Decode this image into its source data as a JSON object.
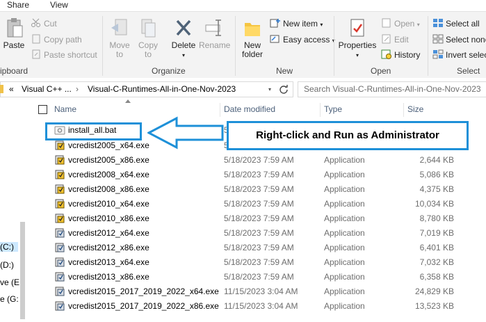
{
  "ribbon_tabs": [
    "Share",
    "View"
  ],
  "clipboard": {
    "paste": "Paste",
    "cut": "Cut",
    "copy_path": "Copy path",
    "paste_shortcut": "Paste shortcut",
    "group": "ipboard"
  },
  "organize": {
    "move_to": [
      "Move",
      "to"
    ],
    "copy_to": [
      "Copy",
      "to"
    ],
    "delete": "Delete",
    "rename": "Rename",
    "group": "Organize"
  },
  "new": {
    "new_folder": [
      "New",
      "folder"
    ],
    "new_item": "New item",
    "easy_access": "Easy access",
    "group": "New"
  },
  "open": {
    "properties": "Properties",
    "open": "Open",
    "edit": "Edit",
    "history": "History",
    "group": "Open"
  },
  "select": {
    "select_all": "Select all",
    "select_none": "Select none",
    "invert_selection": "Invert selec",
    "group": "Select"
  },
  "address": {
    "chevron": "«",
    "segment1": "Visual C++ ...",
    "separator": "›",
    "segment2": "Visual-C-Runtimes-All-in-One-Nov-2023",
    "search_placeholder": "Search Visual-C-Runtimes-All-in-One-Nov-2023"
  },
  "nav": {
    "items": [
      "(C:)",
      "(D:)",
      "ve (E",
      "e (G:"
    ]
  },
  "columns": {
    "name": "Name",
    "date": "Date modified",
    "type": "Type",
    "size": "Size"
  },
  "files": [
    {
      "name": "install_all.bat",
      "date": "5/",
      "type": "",
      "size": "",
      "icon": "bat-file-icon"
    },
    {
      "name": "vcredist2005_x64.exe",
      "date": "5/",
      "type": "",
      "size": "",
      "icon": "installer-icon"
    },
    {
      "name": "vcredist2005_x86.exe",
      "date": "5/18/2023 7:59 AM",
      "type": "Application",
      "size": "2,644 KB",
      "icon": "installer-icon"
    },
    {
      "name": "vcredist2008_x64.exe",
      "date": "5/18/2023 7:59 AM",
      "type": "Application",
      "size": "5,086 KB",
      "icon": "installer-icon"
    },
    {
      "name": "vcredist2008_x86.exe",
      "date": "5/18/2023 7:59 AM",
      "type": "Application",
      "size": "4,375 KB",
      "icon": "installer-icon"
    },
    {
      "name": "vcredist2010_x64.exe",
      "date": "5/18/2023 7:59 AM",
      "type": "Application",
      "size": "10,034 KB",
      "icon": "installer-icon"
    },
    {
      "name": "vcredist2010_x86.exe",
      "date": "5/18/2023 7:59 AM",
      "type": "Application",
      "size": "8,780 KB",
      "icon": "installer-icon"
    },
    {
      "name": "vcredist2012_x64.exe",
      "date": "5/18/2023 7:59 AM",
      "type": "Application",
      "size": "7,019 KB",
      "icon": "installer-icon"
    },
    {
      "name": "vcredist2012_x86.exe",
      "date": "5/18/2023 7:59 AM",
      "type": "Application",
      "size": "6,401 KB",
      "icon": "installer-icon"
    },
    {
      "name": "vcredist2013_x64.exe",
      "date": "5/18/2023 7:59 AM",
      "type": "Application",
      "size": "7,032 KB",
      "icon": "installer-icon"
    },
    {
      "name": "vcredist2013_x86.exe",
      "date": "5/18/2023 7:59 AM",
      "type": "Application",
      "size": "6,358 KB",
      "icon": "installer-icon"
    },
    {
      "name": "vcredist2015_2017_2019_2022_x64.exe",
      "date": "11/15/2023 3:04 AM",
      "type": "Application",
      "size": "24,829 KB",
      "icon": "installer-icon"
    },
    {
      "name": "vcredist2015_2017_2019_2022_x86.exe",
      "date": "11/15/2023 3:04 AM",
      "type": "Application",
      "size": "13,523 KB",
      "icon": "installer-icon"
    }
  ],
  "callout": {
    "text": "Right-click and Run as Administrator",
    "color": "#1e90d8"
  }
}
